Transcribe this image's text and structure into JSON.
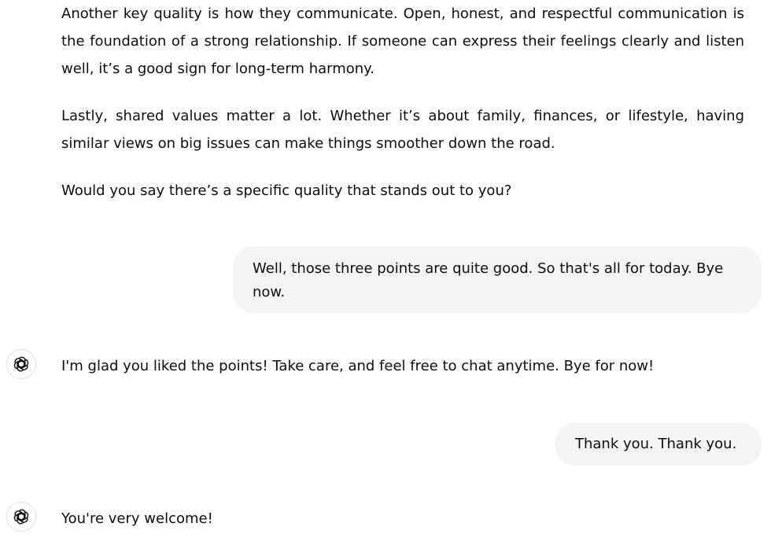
{
  "messages": {
    "assistant_1": {
      "paragraphs": [
        "Another key quality is how they communicate. Open, honest, and respectful communication is the foundation of a strong relationship. If someone can express their feelings clearly and listen well, it’s a good sign for long-term harmony.",
        "Lastly, shared values matter a lot. Whether it’s about family, finances, or lifestyle, having similar views on big issues can make things smoother down the road.",
        "Would you say there’s a specific quality that stands out to you?"
      ]
    },
    "user_1": {
      "text": "Well, those three points are quite good. So that's all for today. Bye now."
    },
    "assistant_2": {
      "icon": "chatgpt-logo-icon",
      "text": "I'm glad you liked the points! Take care, and feel free to chat anytime. Bye for now!"
    },
    "user_2": {
      "text": "Thank you. Thank you."
    },
    "assistant_3": {
      "icon": "chatgpt-logo-icon",
      "text": "You're very welcome!"
    }
  },
  "colors": {
    "user_bubble_bg": "#f4f4f4",
    "text": "#0d0d0d",
    "avatar_border": "#e3e3e3"
  }
}
